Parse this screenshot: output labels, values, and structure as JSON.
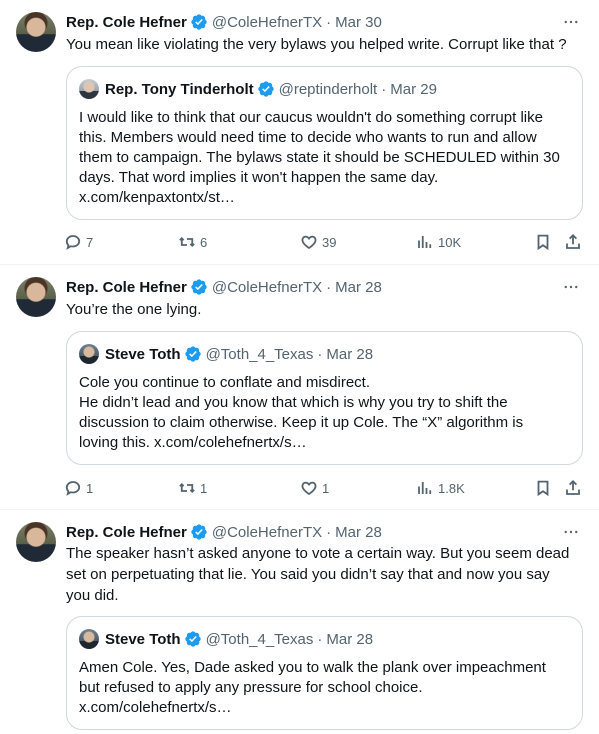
{
  "colors": {
    "verified": "#1d9bf0",
    "text": "#0f1419",
    "muted": "#536471",
    "border": "#cfd9de"
  },
  "tweets": [
    {
      "name": "Rep. Cole Hefner",
      "handle": "@ColeHefnerTX",
      "sep": "·",
      "date": "Mar 30",
      "text": "You mean like violating the very bylaws you helped write. Corrupt like that ?",
      "quote": {
        "name": "Rep. Tony Tinderholt",
        "handle": "@reptinderholt",
        "sep": "·",
        "date": "Mar 29",
        "lines": [
          "I would like to think that our caucus wouldn't do something corrupt like",
          "this. Members  would need time to decide who wants to run and allow",
          "them to campaign. The bylaws state it should be SCHEDULED within 30",
          "days. That word implies it won't happen the same day.",
          "x.com/kenpaxtontx/st…"
        ]
      },
      "replies": "7",
      "reposts": "6",
      "likes": "39",
      "views": "10K"
    },
    {
      "name": "Rep. Cole Hefner",
      "handle": "@ColeHefnerTX",
      "sep": "·",
      "date": "Mar 28",
      "text": "You’re the one lying.",
      "quote": {
        "name": "Steve Toth",
        "handle": "@Toth_4_Texas",
        "sep": "·",
        "date": "Mar 28",
        "lines": [
          "Cole you continue to conflate and misdirect.",
          "He didn’t lead and you know that which is why you try to shift the",
          "discussion to claim otherwise. Keep it up Cole. The “X” algorithm is",
          "loving this. x.com/colehefnertx/s…"
        ]
      },
      "replies": "1",
      "reposts": "1",
      "likes": "1",
      "views": "1.8K"
    },
    {
      "name": "Rep. Cole Hefner",
      "handle": "@ColeHefnerTX",
      "sep": "·",
      "date": "Mar 28",
      "text_lines": [
        "The speaker hasn’t asked anyone to vote a certain way. But you seem dead",
        "set on perpetuating that lie. You said you didn’t say that and now you say",
        "you did."
      ],
      "quote": {
        "name": "Steve Toth",
        "handle": "@Toth_4_Texas",
        "sep": "·",
        "date": "Mar 28",
        "lines": [
          "Amen Cole. Yes, Dade asked you to walk the plank over impeachment",
          "but refused to apply any pressure for school choice.",
          "x.com/colehefnertx/s…"
        ]
      }
    }
  ]
}
